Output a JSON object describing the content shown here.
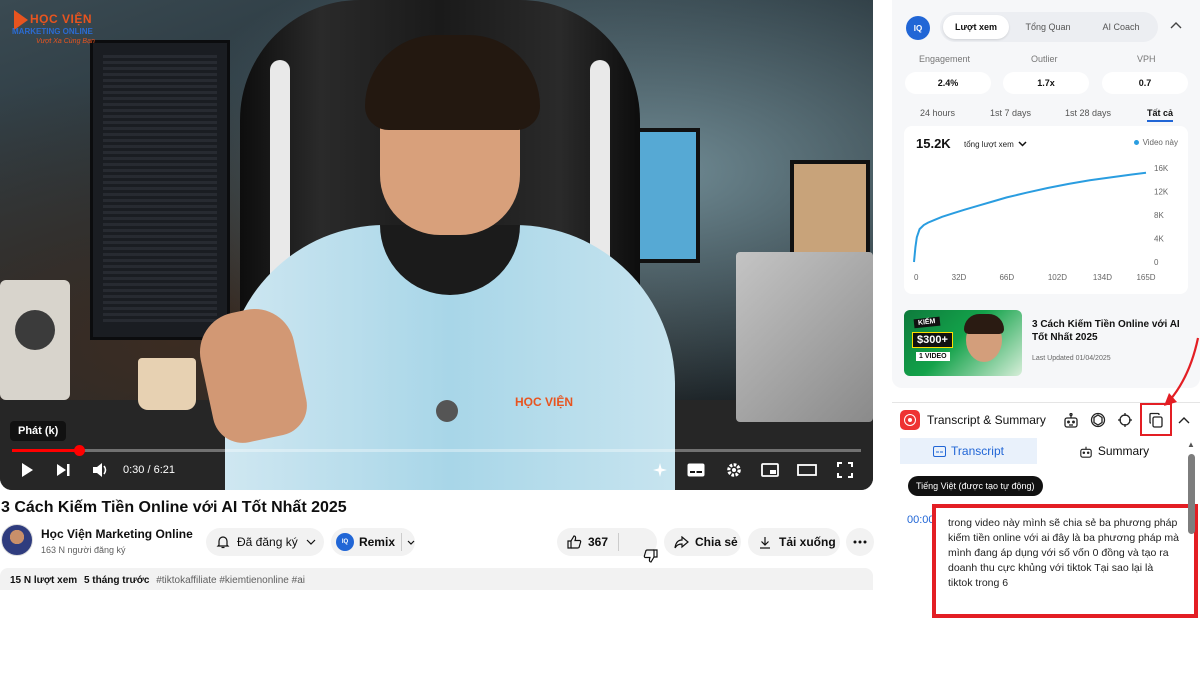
{
  "player": {
    "brand_logo": {
      "line1": "HỌC VIỆN",
      "line2": "MARKETING ONLINE",
      "line3": "Vượt Xa Cùng Bạn"
    },
    "shirt_logo": "HỌC VIỆN",
    "caption_label": "Phát (k)",
    "time_display": "0:30 / 6:21",
    "progress_fraction": 0.079,
    "controls": [
      "play-icon",
      "next-icon",
      "volume-icon",
      "ai-sparkle-icon",
      "subtitles-icon",
      "settings-gear-icon",
      "miniplayer-icon",
      "theater-icon",
      "fullscreen-icon"
    ]
  },
  "video": {
    "title": "3 Cách Kiếm Tiền Online với AI Tốt Nhất 2025",
    "channel_name": "Học Viện Marketing Online",
    "subscribers": "163 N người đăng ký",
    "subscribed_label": "Đã đăng ký",
    "remix_label": "Remix",
    "like_count": "367",
    "share_label": "Chia sẻ",
    "download_label": "Tải xuống",
    "views": "15 N lượt xem",
    "age": "5 tháng trước",
    "tags": "#tiktokaffiliate #kiemtienonline #ai"
  },
  "stats": {
    "badge": "IQ",
    "tabs": [
      "Lượt xem",
      "Tổng Quan",
      "AI Coach"
    ],
    "active_tab": "Lượt xem",
    "metrics": [
      {
        "label": "Engagement",
        "value": "2.4%"
      },
      {
        "label": "Outlier",
        "value": "1.7x"
      },
      {
        "label": "VPH",
        "value": "0.7"
      }
    ],
    "ranges": [
      "24 hours",
      "1st 7 days",
      "1st 28 days",
      "Tất cả"
    ],
    "active_range": "Tất cả",
    "total": "15.2K",
    "dropdown_label": "tổng lượt xem",
    "legend": "Video này",
    "accent_color": "#2a9de0",
    "related": {
      "thumb_kiem": "KIẾM",
      "thumb_money": "$300+",
      "thumb_video": "1 VIDEO",
      "title": "3 Cách Kiếm Tiền Online với AI Tốt Nhất 2025",
      "updated": "Last Updated 01/04/2025"
    }
  },
  "chart_data": {
    "type": "line",
    "title": "",
    "xlabel": "",
    "ylabel": "",
    "x_ticks": [
      "0",
      "32D",
      "66D",
      "102D",
      "134D",
      "165D"
    ],
    "y_ticks": [
      "0",
      "4K",
      "8K",
      "12K",
      "16K"
    ],
    "xlim": [
      0,
      165
    ],
    "ylim": [
      0,
      16000
    ],
    "grid": false,
    "series": [
      {
        "name": "Video này",
        "x": [
          0,
          1,
          2,
          4,
          7,
          10,
          15,
          20,
          28,
          36,
          46,
          56,
          66,
          80,
          95,
          110,
          125,
          140,
          155,
          165
        ],
        "y": [
          0,
          2500,
          4200,
          5600,
          6300,
          6700,
          7200,
          7700,
          8300,
          8900,
          9600,
          10300,
          11000,
          11800,
          12600,
          13300,
          13900,
          14400,
          14900,
          15200
        ]
      }
    ]
  },
  "transcript": {
    "title": "Transcript & Summary",
    "tab_transcript": "Transcript",
    "tab_summary": "Summary",
    "language": "Tiếng Việt (được tạo tự động)",
    "timestamp": "00:00",
    "text": "trong video này mình sẽ chia sẻ ba phương pháp kiếm tiền online với ai đây là ba phương pháp mà mình đang áp dụng với số vốn 0 đồng và tạo ra doanh thu cực khủng với tiktok Tại sao lại là tiktok trong 6",
    "highlight_color": "#e31e24"
  }
}
